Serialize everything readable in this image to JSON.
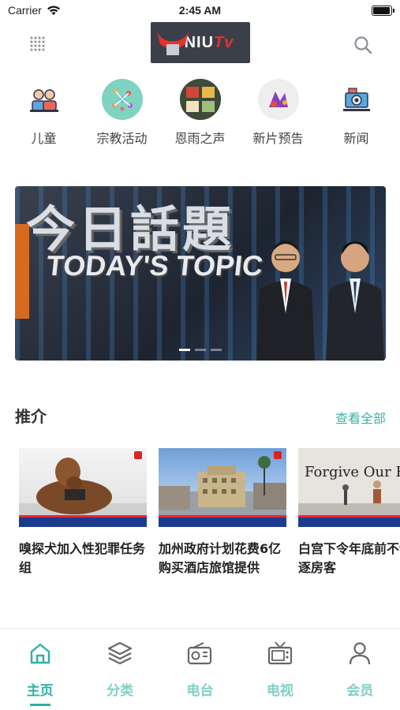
{
  "status": {
    "carrier": "Carrier",
    "time": "2:45 AM",
    "battery_level": 0.95
  },
  "header": {
    "logo_text": "NIU",
    "logo_italic": "Tv",
    "menu_icon": "dots-grid-icon",
    "search_icon": "search-icon"
  },
  "categories": [
    {
      "label": "儿童",
      "icon": "kids-icon"
    },
    {
      "label": "宗教活动",
      "icon": "religion-icon"
    },
    {
      "label": "恩雨之声",
      "icon": "grace-voice-icon"
    },
    {
      "label": "新片预告",
      "icon": "trailer-icon"
    },
    {
      "label": "新闻",
      "icon": "news-icon"
    }
  ],
  "banner": {
    "title_cn": "今日話題",
    "title_en": "TODAY'S TOPIC"
  },
  "recommend": {
    "title": "推介",
    "more": "查看全部",
    "items": [
      {
        "title": "嗅探犬加入性犯罪任务组"
      },
      {
        "title": "加州政府计划花费6亿购买酒店旅馆提供"
      },
      {
        "title": "白宫下令年底前不许驱逐房客",
        "thumb_text": "Forgive Our Re"
      }
    ]
  },
  "tabs": [
    {
      "label": "主页",
      "icon": "home-icon",
      "active": true
    },
    {
      "label": "分类",
      "icon": "layers-icon",
      "active": false
    },
    {
      "label": "电台",
      "icon": "radio-icon",
      "active": false
    },
    {
      "label": "电视",
      "icon": "tv-icon",
      "active": false
    },
    {
      "label": "会员",
      "icon": "user-icon",
      "active": false
    }
  ],
  "colors": {
    "accent": "#2fb0a5",
    "accent_light": "#7fcfc7"
  }
}
